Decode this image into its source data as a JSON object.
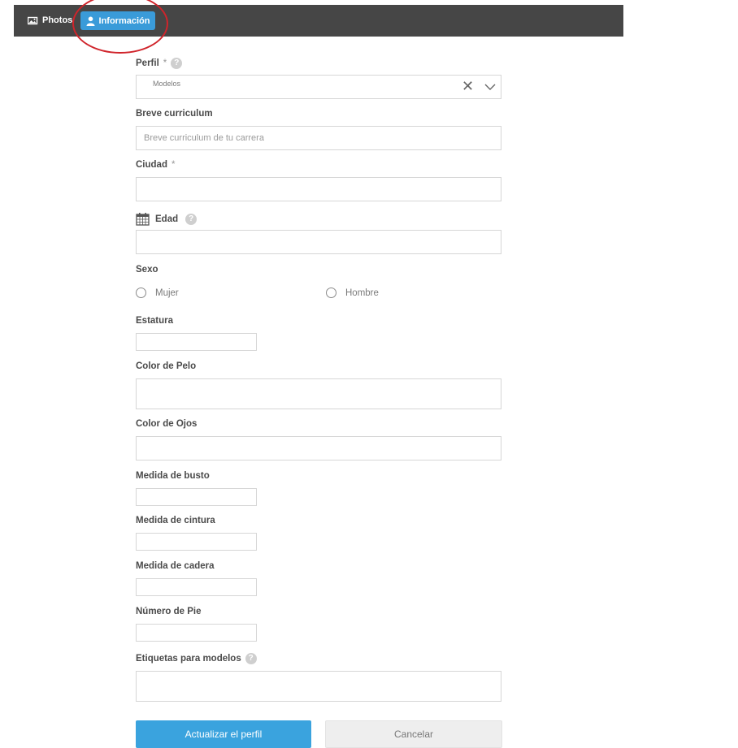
{
  "nav": {
    "tabs": [
      {
        "label": "Photos",
        "icon": "image-icon",
        "active": false
      },
      {
        "label": "Información",
        "icon": "user-icon",
        "active": true
      }
    ],
    "active_color": "#3a9bd9",
    "bar_color": "#464646"
  },
  "annotation": {
    "color": "#d0242b"
  },
  "form": {
    "perfil": {
      "label": "Perfil",
      "required_mark": "*",
      "value": "Modelos"
    },
    "breve_curriculum": {
      "label": "Breve curriculum",
      "placeholder": "Breve curriculum de tu carrera"
    },
    "ciudad": {
      "label": "Ciudad",
      "required_mark": "*",
      "value": ""
    },
    "edad": {
      "label": "Edad",
      "value": ""
    },
    "sexo": {
      "label": "Sexo",
      "options": [
        "Mujer",
        "Hombre"
      ]
    },
    "estatura": {
      "label": "Estatura",
      "value": ""
    },
    "color_pelo": {
      "label": "Color de Pelo",
      "value": ""
    },
    "color_ojos": {
      "label": "Color de Ojos",
      "value": ""
    },
    "medida_busto": {
      "label": "Medida de busto",
      "value": ""
    },
    "medida_cintura": {
      "label": "Medida de cintura",
      "value": ""
    },
    "medida_cadera": {
      "label": "Medida de cadera",
      "value": ""
    },
    "numero_pie": {
      "label": "Número de Pie",
      "value": ""
    },
    "etiquetas": {
      "label": "Etiquetas para modelos",
      "value": ""
    }
  },
  "help_glyph": "?",
  "clear_glyph": "✕",
  "buttons": {
    "submit": "Actualizar el perfil",
    "cancel": "Cancelar"
  }
}
